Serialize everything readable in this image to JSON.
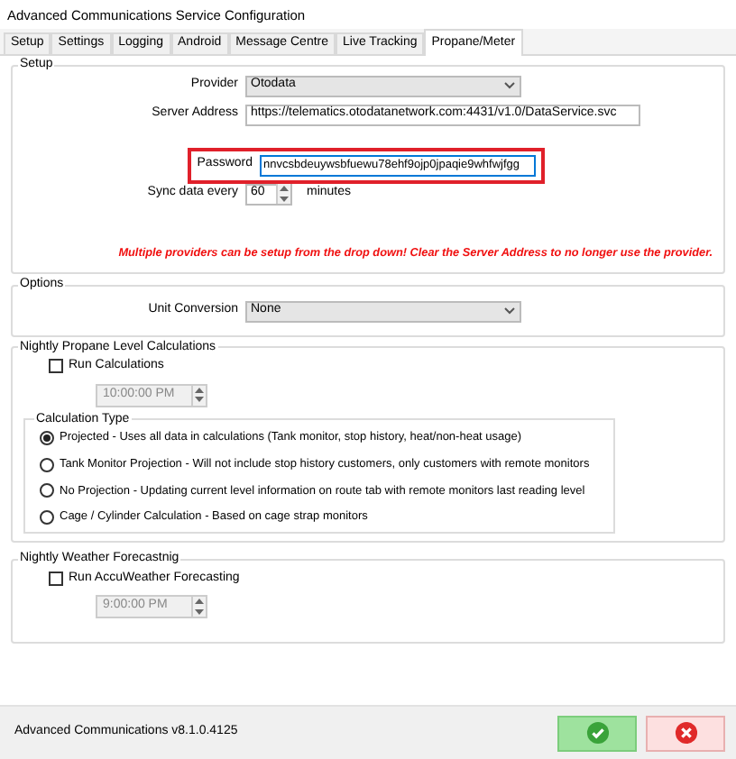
{
  "window": {
    "title": "Advanced Communications Service Configuration"
  },
  "tabs": [
    {
      "label": "Setup",
      "selected": false
    },
    {
      "label": "Settings",
      "selected": false
    },
    {
      "label": "Logging",
      "selected": false
    },
    {
      "label": "Android",
      "selected": false
    },
    {
      "label": "Message Centre",
      "selected": false
    },
    {
      "label": "Live Tracking",
      "selected": false
    },
    {
      "label": "Propane/Meter",
      "selected": true
    }
  ],
  "setup": {
    "title": "Setup",
    "provider_label": "Provider",
    "provider": "Otodata",
    "server_label": "Server Address",
    "server": "https://telematics.otodatanetwork.com:4431/v1.0/DataService.svc",
    "password_label": "Password",
    "password": "nnvcsbdeuywsbfuewu78ehf9ojp0jpaqie9whfwjfgg",
    "password_highlighted": true,
    "sync_label": "Sync data every",
    "sync": "60",
    "sync_unit": "minutes",
    "note": "Multiple providers can be setup from the drop down! Clear the Server Address to no longer use the provider."
  },
  "options": {
    "title": "Options",
    "unit_label": "Unit Conversion",
    "unit": "None"
  },
  "nightly_propane": {
    "title": "Nightly Propane Level Calculations",
    "run_label": "Run Calculations",
    "run_checked": false,
    "time": "10:00:00 PM",
    "time_disabled": true,
    "calc_type": {
      "title": "Calculation Type",
      "options": [
        {
          "label": "Projected - Uses all data in calculations (Tank monitor, stop history, heat/non-heat usage)",
          "selected": true
        },
        {
          "label": "Tank Monitor Projection -  Will not include stop history customers, only customers with remote monitors",
          "selected": false
        },
        {
          "label": "No Projection - Updating current level information on route tab with remote monitors last reading level",
          "selected": false
        },
        {
          "label": "Cage / Cylinder Calculation - Based on cage strap monitors",
          "selected": false
        }
      ]
    }
  },
  "nightly_weather": {
    "title": "Nightly Weather Forecastnig",
    "run_label": "Run AccuWeather Forecasting",
    "run_checked": false,
    "time": "9:00:00 PM",
    "time_disabled": true
  },
  "status_bar": {
    "version": "Advanced Communications v8.1.0.4125"
  }
}
